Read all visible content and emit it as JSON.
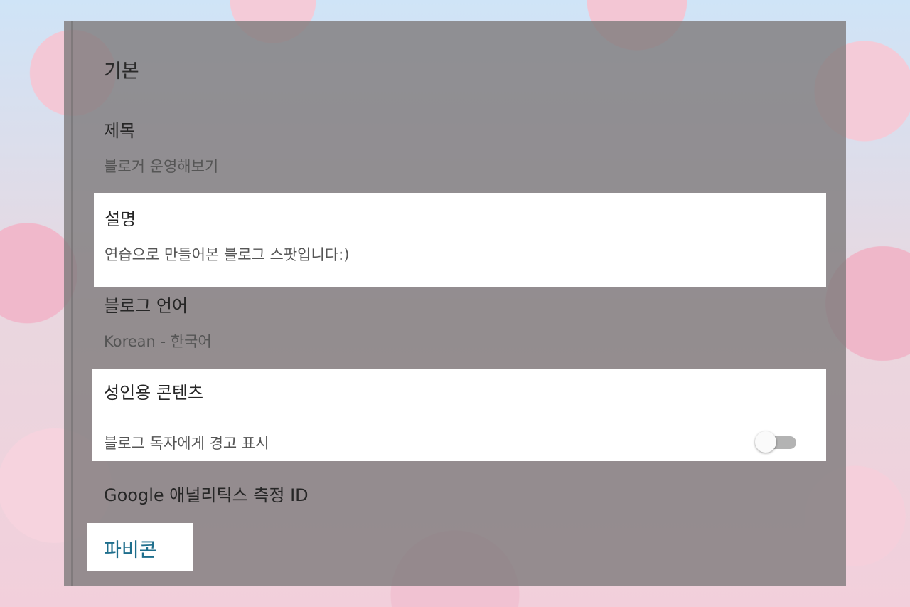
{
  "settings": {
    "section_title": "기본",
    "title": {
      "label": "제목",
      "value": "블로거 운영해보기"
    },
    "description": {
      "label": "설명",
      "value": "연습으로 만들어본 블로그 스팟입니다:)"
    },
    "language": {
      "label": "블로그 언어",
      "value": "Korean - 한국어"
    },
    "adult_content": {
      "label": "성인용 콘텐츠",
      "toggle_label": "블로그 독자에게 경고 표시",
      "toggle_on": false
    },
    "analytics": {
      "label": "Google 애널리틱스 측정 ID"
    },
    "favicon": {
      "label": "파비콘"
    }
  },
  "colors": {
    "link": "#1e6e8c",
    "toggle_track": "#b3b3b3",
    "toggle_thumb": "#fafafa"
  }
}
